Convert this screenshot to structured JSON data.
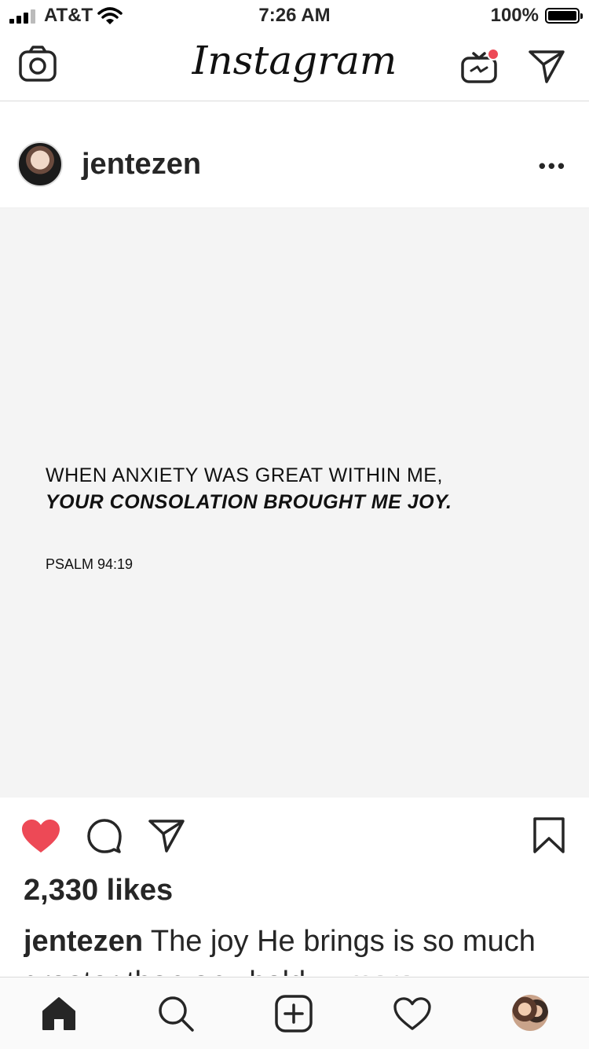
{
  "status_bar": {
    "carrier": "AT&T",
    "time": "7:26 AM",
    "battery": "100%"
  },
  "nav": {
    "logo": "Instagram",
    "icons": [
      "camera-icon",
      "igtv-icon",
      "direct-message-icon"
    ]
  },
  "post": {
    "username": "jentezen",
    "more_label": "•••",
    "image_text": {
      "line1": "WHEN ANXIETY WAS GREAT WITHIN ME,",
      "line2": "YOUR CONSOLATION BROUGHT ME JOY.",
      "reference": "PSALM 94:19"
    },
    "liked": true,
    "like_color": "#ed4956",
    "likes": "2,330 likes",
    "caption": {
      "user": "jentezen",
      "text": "The joy He brings is so much greater than any hold",
      "more": "... more"
    }
  },
  "tab_bar": {
    "items": [
      "home-icon",
      "search-icon",
      "add-post-icon",
      "activity-heart-icon",
      "profile-avatar"
    ]
  }
}
